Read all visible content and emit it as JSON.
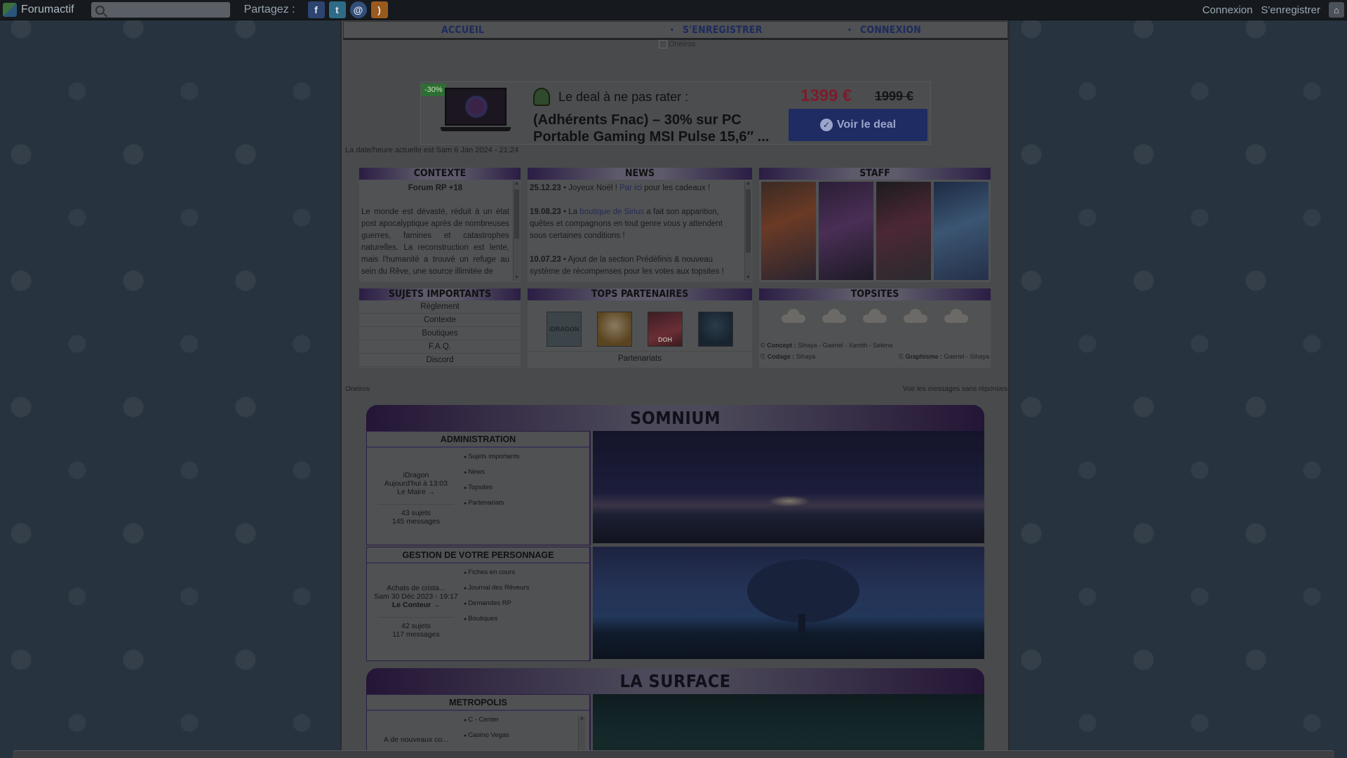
{
  "toolbar": {
    "brand": "Forumactif",
    "search_placeholder": "",
    "share_label": "Partagez :",
    "social": [
      "facebook-icon",
      "twitter-icon",
      "email-icon",
      "rss-icon"
    ],
    "login": "Connexion",
    "register": "S'enregistrer"
  },
  "nav": {
    "home": "Accueil",
    "register": "S'enregistrer",
    "login": "Connexion"
  },
  "banner_alt": "Oneiros",
  "ad": {
    "badge": "-30%",
    "headline": "Le deal à ne pas rater :",
    "title": "(Adhérents Fnac) – 30% sur PC Portable Gaming MSI Pulse 15,6″ ...",
    "price": "1399 €",
    "old_price": "1999 €",
    "cta": "Voir le deal"
  },
  "datetime": "La date/heure actuelle est Sam 6 Jan 2024 - 21:24",
  "contexte": {
    "title": "Contexte",
    "subtitle": "Forum RP +18",
    "text": "Le monde est dévasté, réduit à un état post apocalyptique après de nombreuses guerres, famines et catastrophes naturelles. La reconstruction est lente, mais l'humanité a trouvé un refuge au sein du Rêve, une source illimitée de"
  },
  "news": {
    "title": "News",
    "items": [
      {
        "date": "25.12.23",
        "pre": " • Joyeux Noël ! ",
        "link": "Par ici",
        "post": " pour les cadeaux !"
      },
      {
        "date": "19.08.23",
        "pre": " • La ",
        "link": "boutique de Sirius",
        "post": " a fait son apparition, quêtes et compagnons en tout genre vous y attendent sous certaines conditions !"
      },
      {
        "date": "10.07.23",
        "pre": " • Ajout de la section Prédéfinis & nouveau système de récompenses pour les votes aux topsites !",
        "link": "",
        "post": ""
      }
    ]
  },
  "staff": {
    "title": "Staff"
  },
  "important": {
    "title": "Sujets importants",
    "items": [
      "Règlement",
      "Contexte",
      "Boutiques",
      "F.A.Q.",
      "Discord"
    ]
  },
  "partners": {
    "title": "Tops partenaires",
    "logo_labels": [
      "iDRAGON",
      "",
      "DOH",
      ""
    ],
    "link": "Partenariats"
  },
  "topsites": {
    "title": "Topsites",
    "concept_label": "Concept :",
    "concept": "Sihaya - Gaeriel - Xaroth - Selena",
    "coding_label": "Codage :",
    "coding": "Sihaya",
    "graphics_label": "Graphisme :",
    "graphics": "Gaeriel - Sihaya"
  },
  "footer": {
    "left": "Oneiros",
    "right": "Voir les messages sans réponses"
  },
  "categories": [
    {
      "title": "Somnium",
      "forums": [
        {
          "name": "Administration",
          "last_title": "iDragon",
          "last_date": "Aujourd'hui à 13:03",
          "last_author": "Le Maire",
          "topics": "43 sujets",
          "messages": "145 messages",
          "subforums": [
            "Sujets importants",
            "News",
            "Topsites",
            "Partenariats"
          ]
        },
        {
          "name": "Gestion de votre personnage",
          "last_title": "Achats de crista...",
          "last_date": "Sam 30 Déc 2023 - 19:17",
          "last_author": "Le Conteur",
          "topics": "42 sujets",
          "messages": "117 messages",
          "subforums": [
            "Fiches en cours",
            "Journal des Rêveurs",
            "Demandes RP",
            "Boutiques"
          ]
        }
      ]
    },
    {
      "title": "La Surface",
      "forums": [
        {
          "name": "Metropolis",
          "last_title": "A de nouveaux co...",
          "subforums": [
            "C - Center",
            "Casino Vegas"
          ]
        }
      ]
    }
  ]
}
